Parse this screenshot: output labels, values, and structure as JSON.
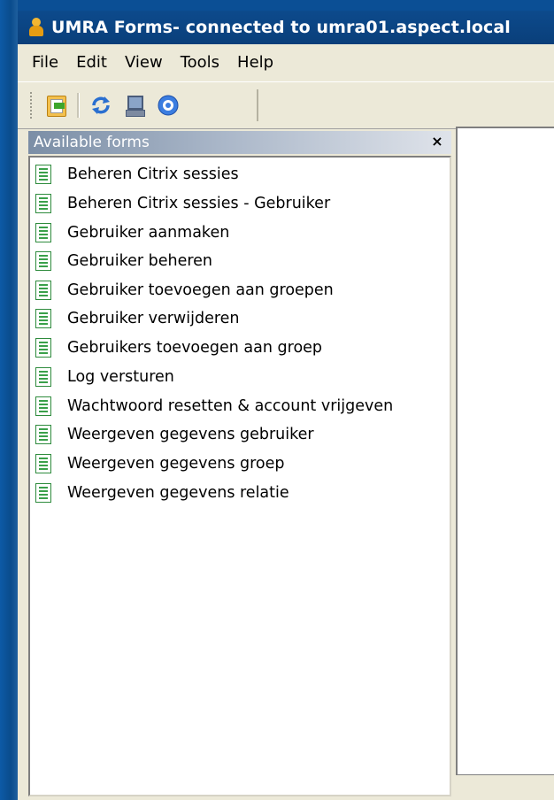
{
  "window": {
    "title": "UMRA Forms- connected to umra01.aspect.local"
  },
  "menu": {
    "items": [
      "File",
      "Edit",
      "View",
      "Tools",
      "Help"
    ]
  },
  "toolbar": {
    "buttons": [
      "open-form-icon",
      "refresh-icon",
      "computer-icon",
      "help-icon"
    ]
  },
  "forms_panel": {
    "title": "Available forms",
    "close_glyph": "×",
    "items": [
      "Beheren Citrix sessies",
      "Beheren Citrix sessies - Gebruiker",
      "Gebruiker aanmaken",
      "Gebruiker beheren",
      "Gebruiker toevoegen aan groepen",
      "Gebruiker verwijderen",
      "Gebruikers toevoegen aan groep",
      "Log versturen",
      "Wachtwoord resetten & account vrijgeven",
      "Weergeven gegevens gebruiker",
      "Weergeven gegevens groep",
      "Weergeven gegevens relatie"
    ]
  },
  "colors": {
    "titlebar": "#0a3f7a",
    "desktop": "#0b4f95",
    "panel_header": "#7b8ea6",
    "form_icon": "#3aa04a"
  }
}
